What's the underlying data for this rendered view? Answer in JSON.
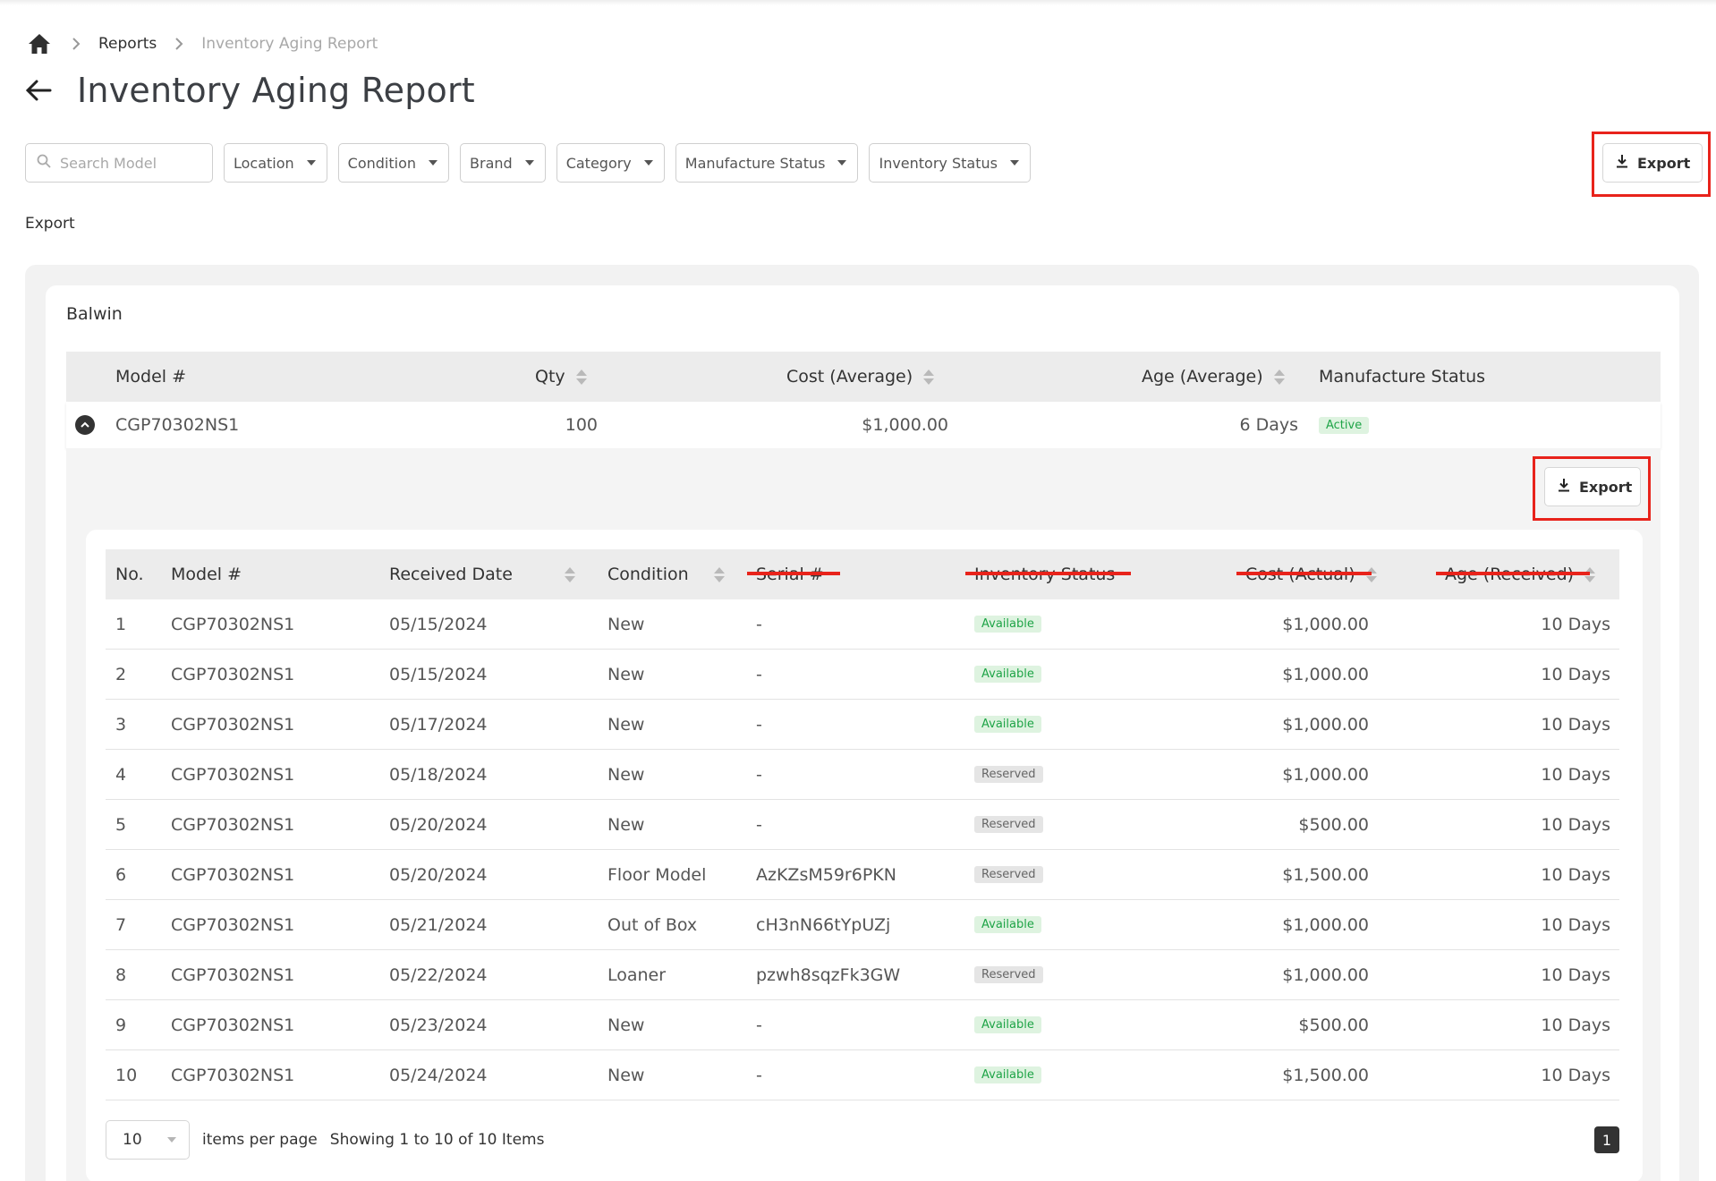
{
  "breadcrumb": {
    "items": [
      "Reports",
      "Inventory Aging Report"
    ]
  },
  "page": {
    "title": "Inventory Aging Report"
  },
  "filters": {
    "search_placeholder": "Search Model",
    "dropdowns": [
      "Location",
      "Condition",
      "Brand",
      "Category",
      "Manufacture Status",
      "Inventory Status"
    ]
  },
  "export": {
    "label": "Export",
    "text_label": "Export",
    "inner_label": "Export"
  },
  "group": {
    "name": "Balwin",
    "columns": [
      "Model #",
      "Qty",
      "Cost (Average)",
      "Age (Average)",
      "Manufacture Status"
    ],
    "row": {
      "model": "CGP70302NS1",
      "qty": "100",
      "cost": "$1,000.00",
      "age": "6 Days",
      "status": "Active"
    }
  },
  "detail": {
    "columns": [
      "No.",
      "Model #",
      "Received Date",
      "Condition",
      "Serial #",
      "Inventory Status",
      "Cost (Actual)",
      "Age (Received)"
    ],
    "rows": [
      {
        "no": "1",
        "model": "CGP70302NS1",
        "date": "05/15/2024",
        "condition": "New",
        "serial": "-",
        "status": "Available",
        "cost": "$1,000.00",
        "age": "10 Days"
      },
      {
        "no": "2",
        "model": "CGP70302NS1",
        "date": "05/15/2024",
        "condition": "New",
        "serial": "-",
        "status": "Available",
        "cost": "$1,000.00",
        "age": "10 Days"
      },
      {
        "no": "3",
        "model": "CGP70302NS1",
        "date": "05/17/2024",
        "condition": "New",
        "serial": "-",
        "status": "Available",
        "cost": "$1,000.00",
        "age": "10 Days"
      },
      {
        "no": "4",
        "model": "CGP70302NS1",
        "date": "05/18/2024",
        "condition": "New",
        "serial": "-",
        "status": "Reserved",
        "cost": "$1,000.00",
        "age": "10 Days"
      },
      {
        "no": "5",
        "model": "CGP70302NS1",
        "date": "05/20/2024",
        "condition": "New",
        "serial": "-",
        "status": "Reserved",
        "cost": "$500.00",
        "age": "10 Days"
      },
      {
        "no": "6",
        "model": "CGP70302NS1",
        "date": "05/20/2024",
        "condition": "Floor Model",
        "serial": "AzKZsM59r6PKN",
        "status": "Reserved",
        "cost": "$1,500.00",
        "age": "10 Days"
      },
      {
        "no": "7",
        "model": "CGP70302NS1",
        "date": "05/21/2024",
        "condition": "Out of Box",
        "serial": "cH3nN66tYpUZj",
        "status": "Available",
        "cost": "$1,000.00",
        "age": "10 Days"
      },
      {
        "no": "8",
        "model": "CGP70302NS1",
        "date": "05/22/2024",
        "condition": "Loaner",
        "serial": "pzwh8sqzFk3GW",
        "status": "Reserved",
        "cost": "$1,000.00",
        "age": "10 Days"
      },
      {
        "no": "9",
        "model": "CGP70302NS1",
        "date": "05/23/2024",
        "condition": "New",
        "serial": "-",
        "status": "Available",
        "cost": "$500.00",
        "age": "10 Days"
      },
      {
        "no": "10",
        "model": "CGP70302NS1",
        "date": "05/24/2024",
        "condition": "New",
        "serial": "-",
        "status": "Available",
        "cost": "$1,500.00",
        "age": "10 Days"
      }
    ]
  },
  "pagination": {
    "per_page": "10",
    "per_page_label": "items per page",
    "summary": "Showing 1 to 10 of 10 Items",
    "current_page": "1"
  },
  "colors": {
    "highlight": "#e8231b",
    "available": "#1fa447",
    "reserved": "#666666"
  }
}
